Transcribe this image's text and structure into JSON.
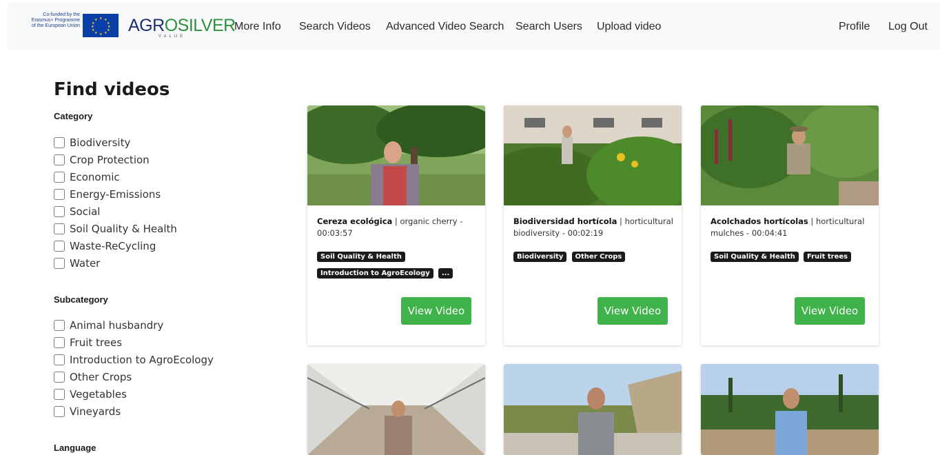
{
  "header": {
    "eu_text_lines": [
      "Co-funded by the",
      "Erasmus+ Programme",
      "of the European Union"
    ],
    "logo_prefix": "AGR",
    "logo_o": "O",
    "logo_suffix": "SILVER",
    "logo_sub": "VALUE",
    "nav": [
      "More Info",
      "Search Videos",
      "Advanced Video Search",
      "Search Users",
      "Upload video"
    ],
    "profile": "Profile",
    "logout": "Log Out"
  },
  "sidebar": {
    "title": "Find videos",
    "category_label": "Category",
    "categories": [
      "Biodiversity",
      "Crop Protection",
      "Economic",
      "Energy-Emissions",
      "Social",
      "Soil Quality & Health",
      "Waste-ReCycling",
      "Water"
    ],
    "subcategory_label": "Subcategory",
    "subcategories": [
      "Animal husbandry",
      "Fruit trees",
      "Introduction to AgroEcology",
      "Other Crops",
      "Vegetables",
      "Vineyards"
    ],
    "language_label": "Language"
  },
  "videos": [
    {
      "title_bold": "Cereza ecológica",
      "title_rest": " | organic cherry - 00:03:57",
      "tags": [
        "Soil Quality & Health",
        "Introduction to AgroEcology",
        "..."
      ],
      "button": "View Video"
    },
    {
      "title_bold": "Biodiversidad hortícola",
      "title_rest": " | horticultural biodiversity - 00:02:19",
      "tags": [
        "Biodiversity",
        "Other Crops"
      ],
      "button": "View Video"
    },
    {
      "title_bold": "Acolchados hortícolas",
      "title_rest": " | horticultural mulches - 00:04:41",
      "tags": [
        "Soil Quality & Health",
        "Fruit trees"
      ],
      "button": "View Video"
    }
  ],
  "colors": {
    "accent_button": "#3fb24a",
    "tag_bg": "#1b1b1b",
    "navbar_bg": "#f8f9fa"
  }
}
